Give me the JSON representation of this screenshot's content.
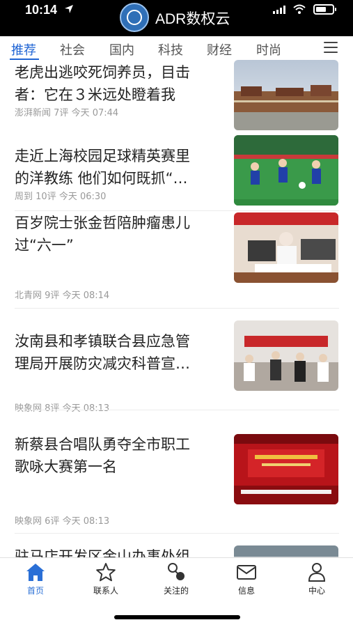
{
  "status_bar": {
    "time": "10:14",
    "app_title": "ADR数权云",
    "logo_text": "ADR数权云"
  },
  "tabs": [
    {
      "label": "推荐",
      "active": true
    },
    {
      "label": "社会"
    },
    {
      "label": "国内"
    },
    {
      "label": "科技"
    },
    {
      "label": "财经"
    },
    {
      "label": "时尚"
    }
  ],
  "news": [
    {
      "title": "老虎出逃咬死饲养员，目击\n者：它在３米远处瞪着我",
      "source": "澎湃新闻",
      "comments": "7评",
      "time": "今天 07:44"
    },
    {
      "title": "走近上海校园足球精英赛里\n的洋教练 他们如何既抓“…",
      "source": "周到",
      "comments": "10评",
      "time": "今天 06:30"
    },
    {
      "title": "百岁院士张金哲陪肿瘤患儿\n过“六一”",
      "source": "北青网",
      "comments": "9评",
      "time": "今天 08:14"
    },
    {
      "title": "汝南县和孝镇联合县应急管\n理局开展防灾减灾科普宣…",
      "source": "映象网",
      "comments": "8评",
      "time": "今天 08:13"
    },
    {
      "title": "新蔡县合唱队勇夺全市职工\n歌咏大赛第一名",
      "source": "映象网",
      "comments": "6评",
      "time": "今天 08:13"
    },
    {
      "title": "驻马店开发区金山办事处组",
      "source": "",
      "comments": "",
      "time": ""
    }
  ],
  "bottom_nav": [
    {
      "label": "首页",
      "icon": "home-icon",
      "active": true
    },
    {
      "label": "联系人",
      "icon": "star-icon"
    },
    {
      "label": "关注的",
      "icon": "follow-icon"
    },
    {
      "label": "信息",
      "icon": "mail-icon"
    },
    {
      "label": "中心",
      "icon": "user-icon"
    }
  ],
  "colors": {
    "accent": "#1f64d4",
    "statusbar": "#000000"
  }
}
